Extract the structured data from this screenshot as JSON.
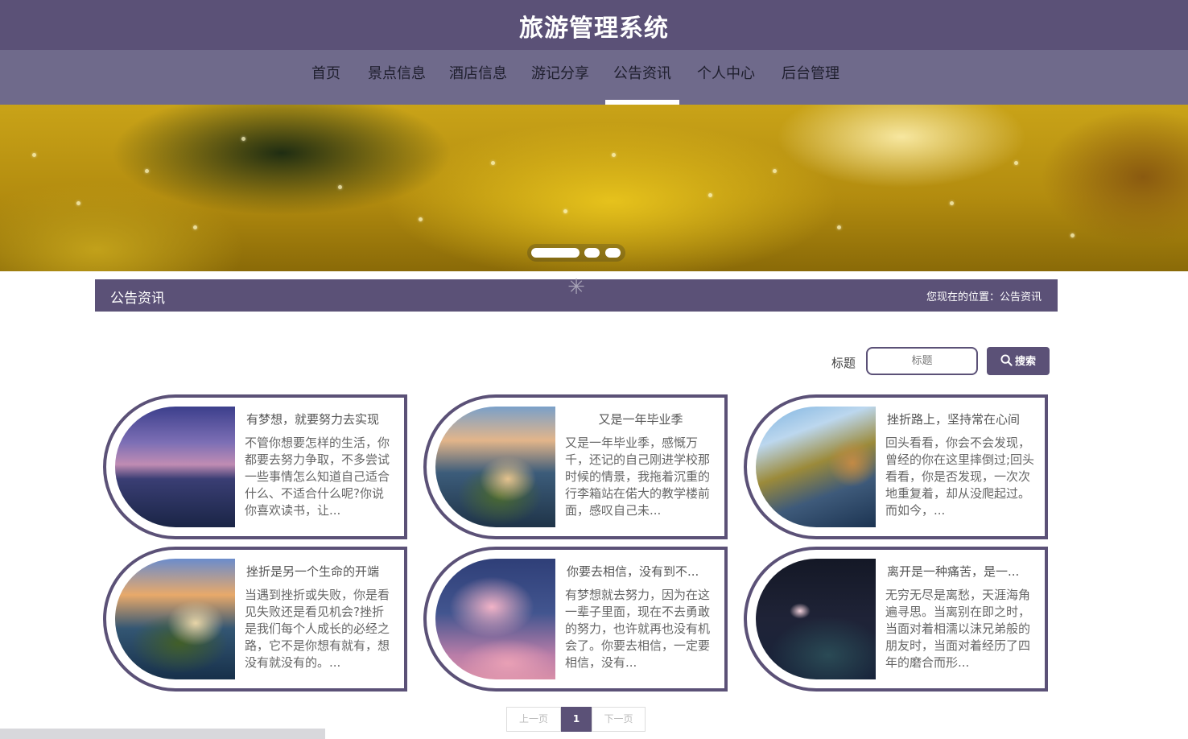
{
  "header": {
    "title": "旅游管理系统"
  },
  "nav": {
    "items": [
      {
        "label": "首页"
      },
      {
        "label": "景点信息"
      },
      {
        "label": "酒店信息"
      },
      {
        "label": "游记分享"
      },
      {
        "label": "公告资讯",
        "active": true
      },
      {
        "label": "个人中心"
      },
      {
        "label": "后台管理"
      }
    ]
  },
  "banner": {
    "slide_count": 3,
    "active_slide": 1
  },
  "section": {
    "title": "公告资讯",
    "breadcrumb": "您现在的位置：公告资讯"
  },
  "search": {
    "label": "标题",
    "placeholder": "标题",
    "button_label": "搜索"
  },
  "cards": [
    {
      "title": "有梦想，就要努力去实现",
      "body": "不管你想要怎样的生活，你都要去努力争取，不多尝试一些事情怎么知道自己适合什么、不适合什么呢?你说你喜欢读书，让..."
    },
    {
      "title": "又是一年毕业季",
      "body": "又是一年毕业季，感慨万千，还记的自己刚进学校那时候的情景，我拖着沉重的行李箱站在偌大的教学楼前面，感叹自己未..."
    },
    {
      "title": "挫折路上，坚持常在心间",
      "body": "回头看看，你会不会发现，曾经的你在这里摔倒过;回头看看，你是否发现，一次次地重复着，却从没爬起过。而如今，..."
    },
    {
      "title": "挫折是另一个生命的开端",
      "body": "当遇到挫折或失败，你是看见失败还是看见机会?挫折是我们每个人成长的必经之路，它不是你想有就有，想没有就没有的。..."
    },
    {
      "title": "你要去相信，没有到不...",
      "body": "有梦想就去努力，因为在这一辈子里面，现在不去勇敢的努力，也许就再也没有机会了。你要去相信，一定要相信，没有..."
    },
    {
      "title": "离开是一种痛苦，是一...",
      "body": "无穷无尽是离愁，天涯海角遍寻思。当离别在即之时，当面对着相濡以沫兄弟般的朋友时，当面对着经历了四年的磨合而形..."
    }
  ],
  "pagination": {
    "prev_label": "上一页",
    "current_page": "1",
    "next_label": "下一页"
  }
}
